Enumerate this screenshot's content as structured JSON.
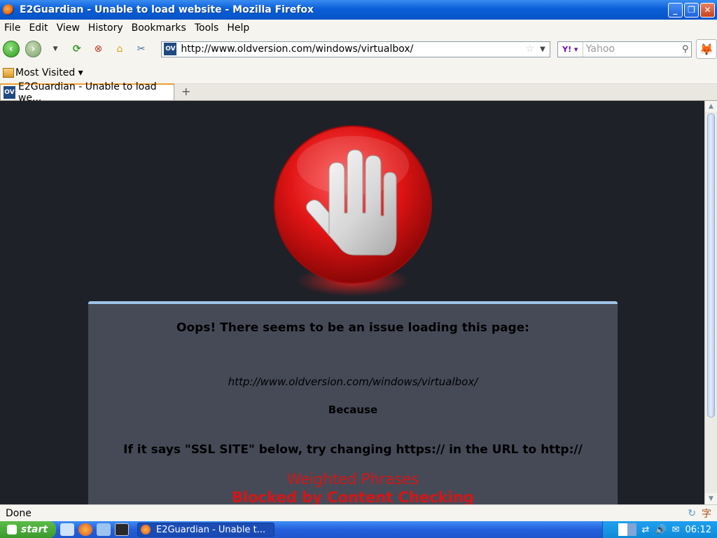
{
  "window": {
    "title": "E2Guardian - Unable to load website - Mozilla Firefox",
    "minimize": "_",
    "maximize": "❐",
    "close": "✕"
  },
  "menu": [
    "File",
    "Edit",
    "View",
    "History",
    "Bookmarks",
    "Tools",
    "Help"
  ],
  "navbar": {
    "url": "http://www.oldversion.com/windows/virtualbox/",
    "favicon_text": "OV",
    "search_placeholder": "Yahoo",
    "search_engine": "Y!"
  },
  "bookmarks": {
    "most_visited": "Most Visited ▾"
  },
  "tab": {
    "label": "E2Guardian - Unable to load we...",
    "new_tab": "+"
  },
  "page": {
    "heading": "Oops! There seems to be an issue loading this page:",
    "url": "http://www.oldversion.com/windows/virtualbox/",
    "because": "Because",
    "ssl_note": "If it says \"SSL SITE\" below, try changing https:// in the URL to http://",
    "reason_1": "Weighted Phrases",
    "reason_2": "Blocked by Content Checking"
  },
  "status": {
    "text": "Done"
  },
  "taskbar": {
    "start": "start",
    "task_label": "E2Guardian - Unable t...",
    "clock": "06:12"
  },
  "colors": {
    "page_background": "#1f2128",
    "panel_background": "#464a57",
    "panel_top_border": "#9fc3e8",
    "reason_red": "#d41616"
  }
}
